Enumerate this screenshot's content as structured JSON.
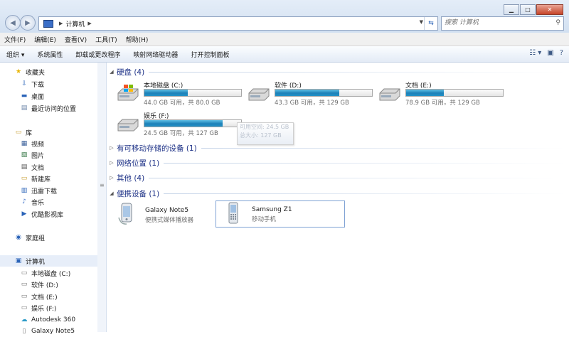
{
  "address": {
    "crumb": "计算机"
  },
  "search": {
    "placeholder": "搜索 计算机"
  },
  "menu": [
    "文件(F)",
    "编辑(E)",
    "查看(V)",
    "工具(T)",
    "帮助(H)"
  ],
  "commands": [
    "组织 ▾",
    "系统属性",
    "卸载或更改程序",
    "映射网络驱动器",
    "打开控制面板"
  ],
  "nav": {
    "favorites": {
      "label": "收藏夹",
      "items": [
        "下载",
        "桌面",
        "最近访问的位置"
      ]
    },
    "library": {
      "label": "库",
      "items": [
        "视频",
        "图片",
        "文档",
        "新建库",
        "迅雷下载",
        "音乐",
        "优酷影视库"
      ]
    },
    "homegroup": "家庭组",
    "computer": {
      "label": "计算机",
      "items": [
        "本地磁盘 (C:)",
        "软件 (D:)",
        "文档 (E:)",
        "娱乐 (F:)",
        "Autodesk 360",
        "Galaxy Note5"
      ]
    }
  },
  "groups": {
    "harddisk": "硬盘 (4)",
    "removable": "有可移动存储的设备 (1)",
    "network": "网络位置 (1)",
    "other": "其他 (4)",
    "portable": "便携设备 (1)"
  },
  "drives": [
    {
      "name": "本地磁盘 (C:)",
      "info": "44.0 GB 可用，共 80.0 GB",
      "used_fraction": 0.45
    },
    {
      "name": "软件 (D:)",
      "info": "43.3 GB 可用，共 129 GB",
      "used_fraction": 0.66
    },
    {
      "name": "文档 (E:)",
      "info": "78.9 GB 可用，共 129 GB",
      "used_fraction": 0.39
    },
    {
      "name": "娱乐 (F:)",
      "info": "24.5 GB 可用，共 127 GB",
      "used_fraction": 0.81
    }
  ],
  "tooltip": {
    "line1": "可用空间: 24.5 GB",
    "line2": "总大小: 127 GB"
  },
  "devices": [
    {
      "name": "Galaxy Note5",
      "type": "便携式媒体播放器"
    },
    {
      "name": "Samsung Z1",
      "type": "移动手机"
    }
  ]
}
